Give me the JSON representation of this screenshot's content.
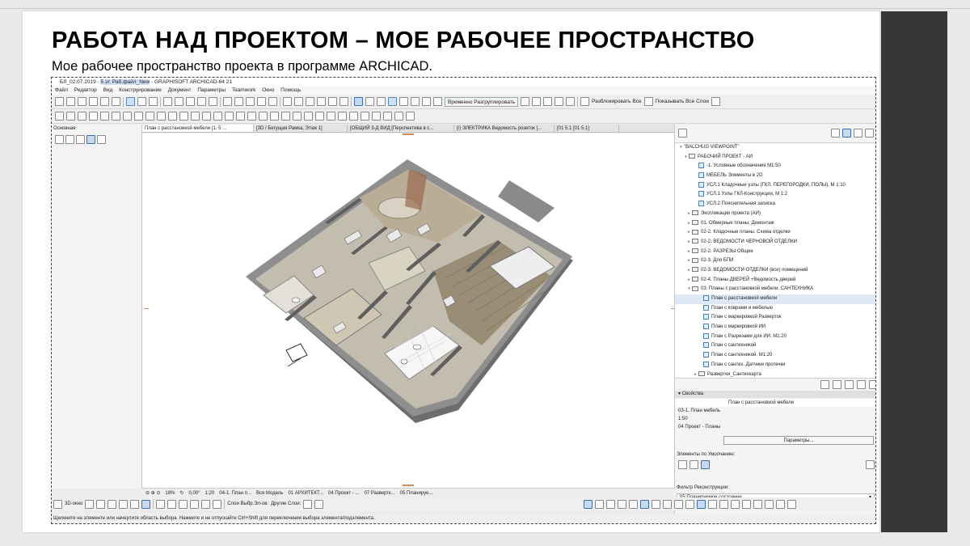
{
  "slide": {
    "title": "РАБОТА НАД ПРОЕКТОМ – МОЕ РАБОЧЕЕ ПРОСТРАНСТВО",
    "subtitle": "Мое рабочее пространство проекта в программе ARCHICAD."
  },
  "app": {
    "title_prefix": "БЛ_02.07.2019 - ",
    "title_hl": "5 эт. Раб.файл_New",
    "title_suffix": " - GRAPHISOFT ARCHICAD-64 21",
    "menu": [
      "Файл",
      "Редактор",
      "Вид",
      "Конструирование",
      "Документ",
      "Параметры",
      "Teamwork",
      "Окно",
      "Помощь"
    ],
    "toolbar": {
      "suspend_groups": "Временно Разгруппировать",
      "unlock_all": "Разблокировать Все",
      "show_all_layers": "Показывать Все Слои"
    },
    "left_panel_label": "Основная",
    "tabs": [
      "План с расстановкой мебели [1. 5 ...",
      "[3D / Бегущая Рамка, Этаж 1]",
      "[ОБЩИЙ 3-Д ВИД [Перспектива в с...",
      "[/) ЭЛЕКТРИКА Ведомость розеток [...",
      "[01 5.1 [01 5.1]"
    ],
    "navigator": {
      "items": [
        {
          "label": "\"BALCHUG VIEWPOINT\"",
          "kind": "root"
        },
        {
          "label": "РАБОЧИЙ ПРОЕКТ - АИ",
          "kind": "open"
        },
        {
          "label": "-1. Условные обозначения М1:50",
          "kind": "view"
        },
        {
          "label": "МЕБЕЛЬ Элементы в 2D",
          "kind": "view"
        },
        {
          "label": "УСЛ.1 Кладочные узлы (ГКЛ, ПЕРЕГОРОДКИ, ПОЛЫ), М 1:10",
          "kind": "view"
        },
        {
          "label": "УСЛ.1 Узлы ГКЛ-Конструкции, М 1:2",
          "kind": "view"
        },
        {
          "label": "УСЛ.2 Пояснительная записка",
          "kind": "view"
        },
        {
          "label": "Экспликации проекта (АИ)",
          "kind": "folder"
        },
        {
          "label": "01. Обмерные планы, Демонтаж",
          "kind": "folder"
        },
        {
          "label": "02-2. Кладочные планы. Схема отделки",
          "kind": "folder"
        },
        {
          "label": "02-2. ВЕДОМОСТИ ЧЕРНОВОЙ ОТДЕЛКИ",
          "kind": "folder"
        },
        {
          "label": "02-2. РАЗРЕЗЫ Общие",
          "kind": "folder"
        },
        {
          "label": "02-3. Для БПИ",
          "kind": "folder"
        },
        {
          "label": "02-3. ВЕДОМОСТИ ОТДЕЛКИ (все) помещений",
          "kind": "folder"
        },
        {
          "label": "02-4. Планы ДВЕРЕЙ +Ведомость дверей",
          "kind": "folder"
        },
        {
          "label": "03. Планы с расстановкой мебели. САНТЕХНИКА",
          "kind": "openfolder"
        },
        {
          "label": "План с расстановкой мебели",
          "kind": "sel"
        },
        {
          "label": "План с коврами и мебелью",
          "kind": "sub"
        },
        {
          "label": "План с маркировкой Разверток",
          "kind": "sub"
        },
        {
          "label": "План с маркировкой ИИ",
          "kind": "sub"
        },
        {
          "label": "План с Разрезами для ИИ. М1:20",
          "kind": "sub"
        },
        {
          "label": "План с сантехникой",
          "kind": "sub"
        },
        {
          "label": "План с сантехникой. М1:20",
          "kind": "sub"
        },
        {
          "label": "План с сантех. Датчики протечки",
          "kind": "sub"
        },
        {
          "label": "Развертки_Сантехкарта",
          "kind": "subfolder"
        }
      ]
    },
    "properties": {
      "header": "Свойства",
      "name": "План с расстановкой мебели",
      "id": "03-1. План мебель",
      "scale": "1:50",
      "layer_set": "04 Проект - Планы",
      "params_button": "Параметры...",
      "defaults_label": "Элементы по Умолчанию:",
      "recon_label": "Фильтр Реконструкции:",
      "recon_value": "05 Планируемое состояние"
    },
    "navbar": {
      "zoom": "18%",
      "angle": "0,00°",
      "scale": "1:20",
      "items": [
        "04-1. План п...",
        "Вся Модель",
        "01 АРХИТЕКТ...",
        "04 Проект - ...",
        "07 Развертк...",
        "05 Планируе..."
      ]
    },
    "bottom": {
      "view3d": "3D-окно",
      "layers1": "Слои Выбр.Эл-ов:",
      "layers2": "Другие Слои:"
    },
    "status": "Щелкните на элементе или начертите область выбора. Нажмите и не отпускайте Ctrl+Shift для переключения выбора элемента/подэлемента."
  },
  "colors": {
    "accent": "#3f6fa7",
    "floor_wood": "#9a8d76",
    "floor_tile": "#d6d2c6",
    "wall": "#6e6e6e",
    "wall_top": "#8b8b8b"
  }
}
